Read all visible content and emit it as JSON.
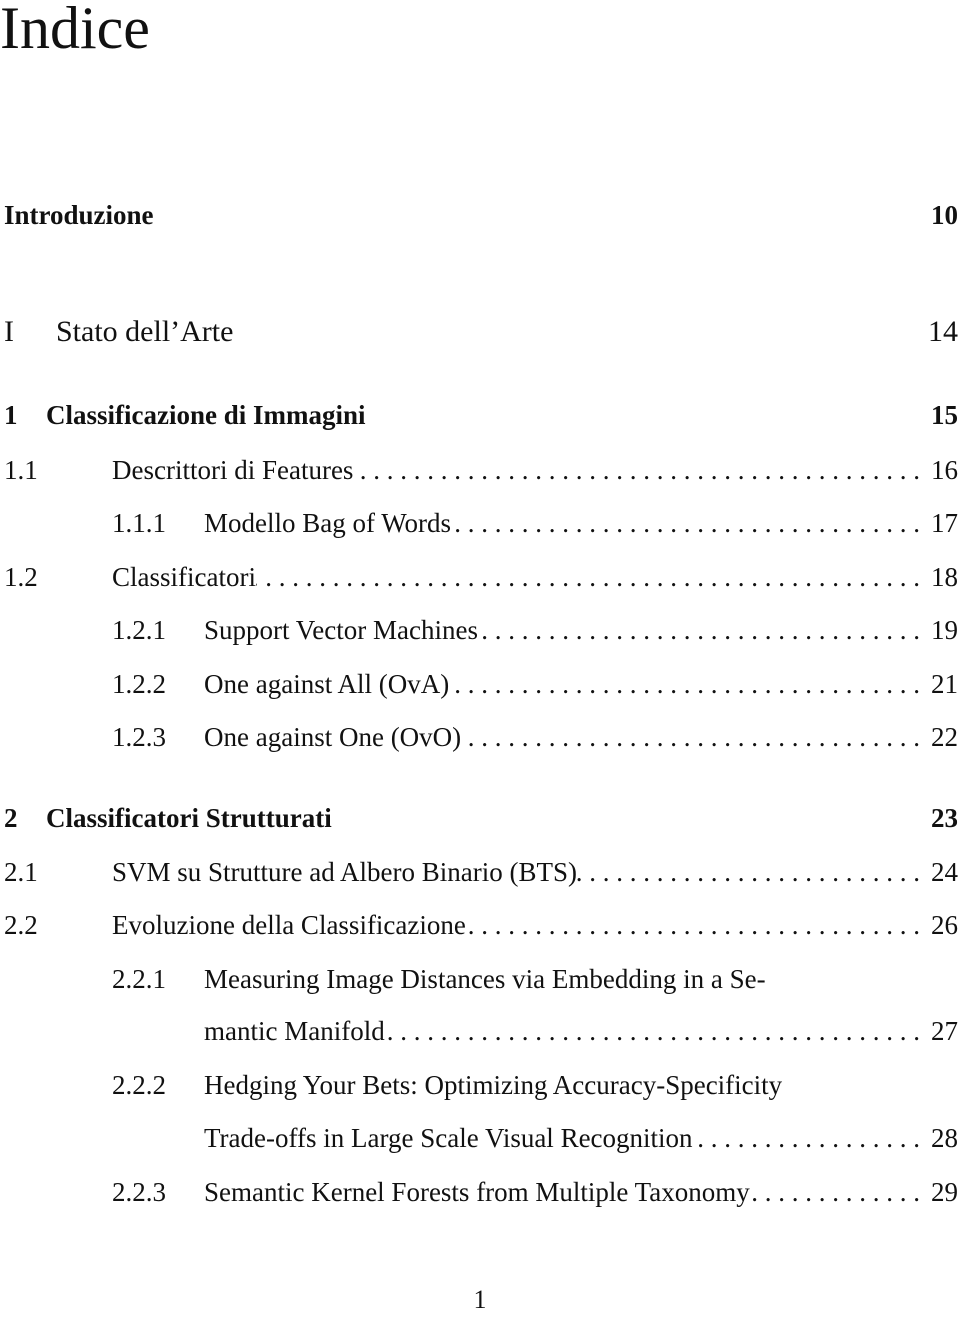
{
  "heading": "Indice",
  "entries": [
    {
      "num": "",
      "label": "Introduzione",
      "page": "10",
      "style": "bold",
      "level": 0,
      "dots": false
    },
    {
      "num": "I",
      "label": "Stato dell’Arte",
      "page": "14",
      "style": "part",
      "level": 0,
      "dots": false
    },
    {
      "num": "1",
      "label": "Classificazione di Immagini",
      "page": "15",
      "style": "bold",
      "level": 0,
      "dots": false
    },
    {
      "num": "1.1",
      "label": "Descrittori di Features",
      "page": "16",
      "style": "",
      "level": 1,
      "dots": true
    },
    {
      "num": "1.1.1",
      "label": "Modello Bag of Words",
      "page": "17",
      "style": "",
      "level": 2,
      "dots": true
    },
    {
      "num": "1.2",
      "label": "Classificatori",
      "page": "18",
      "style": "",
      "level": 1,
      "dots": true
    },
    {
      "num": "1.2.1",
      "label": "Support Vector Machines",
      "page": "19",
      "style": "",
      "level": 2,
      "dots": true
    },
    {
      "num": "1.2.2",
      "label": "One against All (OvA)",
      "page": "21",
      "style": "",
      "level": 2,
      "dots": true
    },
    {
      "num": "1.2.3",
      "label": "One against One (OvO)",
      "page": "22",
      "style": "",
      "level": 2,
      "dots": true
    },
    {
      "num": "2",
      "label": "Classificatori Strutturati",
      "page": "23",
      "style": "bold",
      "level": 0,
      "dots": false
    },
    {
      "num": "2.1",
      "label": "SVM su Strutture ad Albero Binario (BTS)",
      "page": "24",
      "style": "",
      "level": 1,
      "dots": true
    },
    {
      "num": "2.2",
      "label": "Evoluzione della Classificazione",
      "page": "26",
      "style": "",
      "level": 1,
      "dots": true
    },
    {
      "num": "2.2.1",
      "label": "Measuring Image Distances via Embedding in a Se-",
      "page": "",
      "style": "",
      "level": 2,
      "dots": false
    },
    {
      "num": "",
      "label": "mantic Manifold",
      "page": "27",
      "style": "",
      "level": 2,
      "dots": true
    },
    {
      "num": "2.2.2",
      "label": "Hedging Your Bets: Optimizing Accuracy-Specificity",
      "page": "",
      "style": "",
      "level": 2,
      "dots": false
    },
    {
      "num": "",
      "label": "Trade-offs in Large Scale Visual Recognition",
      "page": "28",
      "style": "",
      "level": 2,
      "dots": true
    },
    {
      "num": "2.2.3",
      "label": "Semantic Kernel Forests from Multiple Taxonomy",
      "page": "29",
      "style": "",
      "level": 2,
      "dots": true
    }
  ],
  "page_number": "1"
}
